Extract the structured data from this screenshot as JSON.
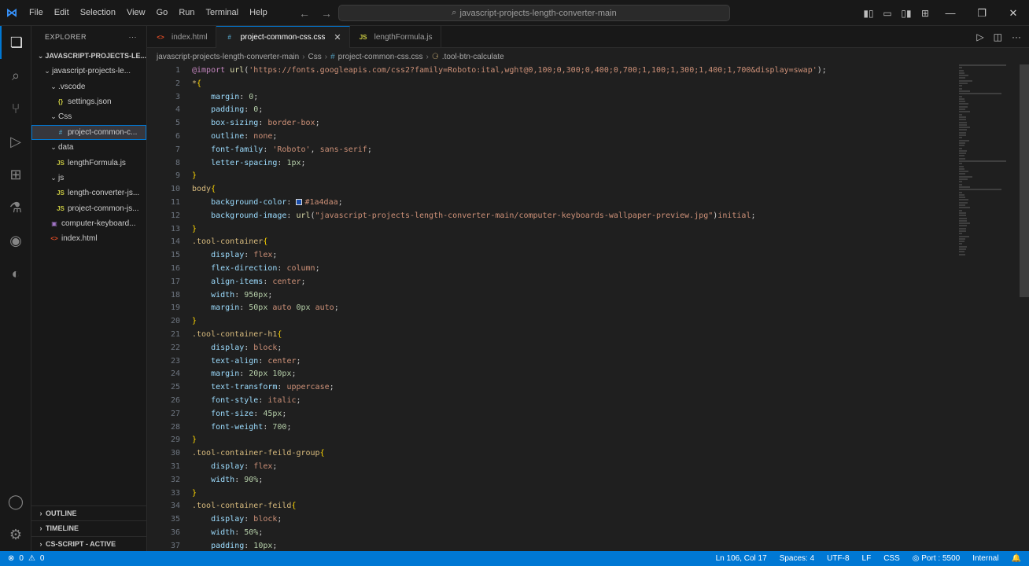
{
  "window": {
    "menu": [
      "File",
      "Edit",
      "Selection",
      "View",
      "Go",
      "Run",
      "Terminal",
      "Help"
    ],
    "command_center": "javascript-projects-length-converter-main"
  },
  "sidebar": {
    "title": "EXPLORER",
    "root": "JAVASCRIPT-PROJECTS-LE...",
    "items": [
      {
        "label": "javascript-projects-le...",
        "depth": 1,
        "type": "folder"
      },
      {
        "label": ".vscode",
        "depth": 2,
        "type": "folder"
      },
      {
        "label": "settings.json",
        "depth": 3,
        "type": "json"
      },
      {
        "label": "Css",
        "depth": 2,
        "type": "folder"
      },
      {
        "label": "project-common-c...",
        "depth": 3,
        "type": "css",
        "selected": true
      },
      {
        "label": "data",
        "depth": 2,
        "type": "folder"
      },
      {
        "label": "lengthFormula.js",
        "depth": 3,
        "type": "js"
      },
      {
        "label": "js",
        "depth": 2,
        "type": "folder"
      },
      {
        "label": "length-converter-js...",
        "depth": 3,
        "type": "js"
      },
      {
        "label": "project-common-js...",
        "depth": 3,
        "type": "js"
      },
      {
        "label": "computer-keyboard...",
        "depth": 2,
        "type": "img"
      },
      {
        "label": "index.html",
        "depth": 2,
        "type": "html"
      }
    ],
    "panels": [
      "OUTLINE",
      "TIMELINE",
      "CS-SCRIPT - ACTIVE"
    ]
  },
  "tabs": [
    {
      "label": "index.html",
      "icon": "html",
      "active": false
    },
    {
      "label": "project-common-css.css",
      "icon": "css",
      "active": true
    },
    {
      "label": "lengthFormula.js",
      "icon": "js",
      "active": false
    }
  ],
  "breadcrumb": [
    "javascript-projects-length-converter-main",
    "Css",
    "project-common-css.css",
    ".tool-btn-calculate"
  ],
  "status": {
    "errors": "0",
    "warnings": "0",
    "position": "Ln 106, Col 17",
    "spaces": "Spaces: 4",
    "encoding": "UTF-8",
    "eol": "LF",
    "language": "CSS",
    "port": "Port : 5500",
    "server": "Internal"
  },
  "code": [
    [
      [
        "at",
        "@import"
      ],
      [
        "p",
        " "
      ],
      [
        "fn",
        "url"
      ],
      [
        "p",
        "("
      ],
      [
        "str",
        "'https://fonts.googleapis.com/css2?family=Roboto:ital,wght@0,100;0,300;0,400;0,700;1,100;1,300;1,400;1,700&display=swap'"
      ],
      [
        "p",
        ");"
      ]
    ],
    [
      [
        "sel",
        "*"
      ],
      [
        "brace",
        "{"
      ]
    ],
    [
      [
        "p",
        "    "
      ],
      [
        "prop",
        "margin"
      ],
      [
        "p",
        ": "
      ],
      [
        "num",
        "0"
      ],
      [
        "p",
        ";"
      ]
    ],
    [
      [
        "p",
        "    "
      ],
      [
        "prop",
        "padding"
      ],
      [
        "p",
        ": "
      ],
      [
        "num",
        "0"
      ],
      [
        "p",
        ";"
      ]
    ],
    [
      [
        "p",
        "    "
      ],
      [
        "prop",
        "box-sizing"
      ],
      [
        "p",
        ": "
      ],
      [
        "val",
        "border-box"
      ],
      [
        "p",
        ";"
      ]
    ],
    [
      [
        "p",
        "    "
      ],
      [
        "prop",
        "outline"
      ],
      [
        "p",
        ": "
      ],
      [
        "val",
        "none"
      ],
      [
        "p",
        ";"
      ]
    ],
    [
      [
        "p",
        "    "
      ],
      [
        "prop",
        "font-family"
      ],
      [
        "p",
        ": "
      ],
      [
        "str",
        "'Roboto'"
      ],
      [
        "p",
        ", "
      ],
      [
        "val",
        "sans-serif"
      ],
      [
        "p",
        ";"
      ]
    ],
    [
      [
        "p",
        "    "
      ],
      [
        "prop",
        "letter-spacing"
      ],
      [
        "p",
        ": "
      ],
      [
        "num",
        "1px"
      ],
      [
        "p",
        ";"
      ]
    ],
    [
      [
        "brace",
        "}"
      ]
    ],
    [
      [
        "sel",
        "body"
      ],
      [
        "brace",
        "{"
      ]
    ],
    [
      [
        "p",
        "    "
      ],
      [
        "prop",
        "background-color"
      ],
      [
        "p",
        ": "
      ],
      [
        "swatch",
        ""
      ],
      [
        "val",
        "#1a4daa"
      ],
      [
        "p",
        ";"
      ]
    ],
    [
      [
        "p",
        "    "
      ],
      [
        "prop",
        "background-image"
      ],
      [
        "p",
        ": "
      ],
      [
        "fn",
        "url"
      ],
      [
        "p",
        "("
      ],
      [
        "str",
        "\"javascript-projects-length-converter-main/computer-keyboards-wallpaper-preview.jpg\""
      ],
      [
        "p",
        ")"
      ],
      [
        "val",
        "initial"
      ],
      [
        "p",
        ";"
      ]
    ],
    [
      [
        "brace",
        "}"
      ]
    ],
    [
      [
        "sel",
        ".tool-container"
      ],
      [
        "brace",
        "{"
      ]
    ],
    [
      [
        "p",
        "    "
      ],
      [
        "prop",
        "display"
      ],
      [
        "p",
        ": "
      ],
      [
        "val",
        "flex"
      ],
      [
        "p",
        ";"
      ]
    ],
    [
      [
        "p",
        "    "
      ],
      [
        "prop",
        "flex-direction"
      ],
      [
        "p",
        ": "
      ],
      [
        "val",
        "column"
      ],
      [
        "p",
        ";"
      ]
    ],
    [
      [
        "p",
        "    "
      ],
      [
        "prop",
        "align-items"
      ],
      [
        "p",
        ": "
      ],
      [
        "val",
        "center"
      ],
      [
        "p",
        ";"
      ]
    ],
    [
      [
        "p",
        "    "
      ],
      [
        "prop",
        "width"
      ],
      [
        "p",
        ": "
      ],
      [
        "num",
        "950px"
      ],
      [
        "p",
        ";"
      ]
    ],
    [
      [
        "p",
        "    "
      ],
      [
        "prop",
        "margin"
      ],
      [
        "p",
        ": "
      ],
      [
        "num",
        "50px"
      ],
      [
        "p",
        " "
      ],
      [
        "val",
        "auto"
      ],
      [
        "p",
        " "
      ],
      [
        "num",
        "0px"
      ],
      [
        "p",
        " "
      ],
      [
        "val",
        "auto"
      ],
      [
        "p",
        ";"
      ]
    ],
    [
      [
        "brace",
        "}"
      ]
    ],
    [
      [
        "sel",
        ".tool-container-h1"
      ],
      [
        "brace",
        "{"
      ]
    ],
    [
      [
        "p",
        "    "
      ],
      [
        "prop",
        "display"
      ],
      [
        "p",
        ": "
      ],
      [
        "val",
        "block"
      ],
      [
        "p",
        ";"
      ]
    ],
    [
      [
        "p",
        "    "
      ],
      [
        "prop",
        "text-align"
      ],
      [
        "p",
        ": "
      ],
      [
        "val",
        "center"
      ],
      [
        "p",
        ";"
      ]
    ],
    [
      [
        "p",
        "    "
      ],
      [
        "prop",
        "margin"
      ],
      [
        "p",
        ": "
      ],
      [
        "num",
        "20px"
      ],
      [
        "p",
        " "
      ],
      [
        "num",
        "10px"
      ],
      [
        "p",
        ";"
      ]
    ],
    [
      [
        "p",
        "    "
      ],
      [
        "prop",
        "text-transform"
      ],
      [
        "p",
        ": "
      ],
      [
        "val",
        "uppercase"
      ],
      [
        "p",
        ";"
      ]
    ],
    [
      [
        "p",
        "    "
      ],
      [
        "prop",
        "font-style"
      ],
      [
        "p",
        ": "
      ],
      [
        "val",
        "italic"
      ],
      [
        "p",
        ";"
      ]
    ],
    [
      [
        "p",
        "    "
      ],
      [
        "prop",
        "font-size"
      ],
      [
        "p",
        ": "
      ],
      [
        "num",
        "45px"
      ],
      [
        "p",
        ";"
      ]
    ],
    [
      [
        "p",
        "    "
      ],
      [
        "prop",
        "font-weight"
      ],
      [
        "p",
        ": "
      ],
      [
        "num",
        "700"
      ],
      [
        "p",
        ";"
      ]
    ],
    [
      [
        "brace",
        "}"
      ]
    ],
    [
      [
        "sel",
        ".tool-container-feild-group"
      ],
      [
        "brace",
        "{"
      ]
    ],
    [
      [
        "p",
        "    "
      ],
      [
        "prop",
        "display"
      ],
      [
        "p",
        ": "
      ],
      [
        "val",
        "flex"
      ],
      [
        "p",
        ";"
      ]
    ],
    [
      [
        "p",
        "    "
      ],
      [
        "prop",
        "width"
      ],
      [
        "p",
        ": "
      ],
      [
        "num",
        "90%"
      ],
      [
        "p",
        ";"
      ]
    ],
    [
      [
        "brace",
        "}"
      ]
    ],
    [
      [
        "sel",
        ".tool-container-feild"
      ],
      [
        "brace",
        "{"
      ]
    ],
    [
      [
        "p",
        "    "
      ],
      [
        "prop",
        "display"
      ],
      [
        "p",
        ": "
      ],
      [
        "val",
        "block"
      ],
      [
        "p",
        ";"
      ]
    ],
    [
      [
        "p",
        "    "
      ],
      [
        "prop",
        "width"
      ],
      [
        "p",
        ": "
      ],
      [
        "num",
        "50%"
      ],
      [
        "p",
        ";"
      ]
    ],
    [
      [
        "p",
        "    "
      ],
      [
        "prop",
        "padding"
      ],
      [
        "p",
        ": "
      ],
      [
        "num",
        "10px"
      ],
      [
        "p",
        ";"
      ]
    ]
  ]
}
